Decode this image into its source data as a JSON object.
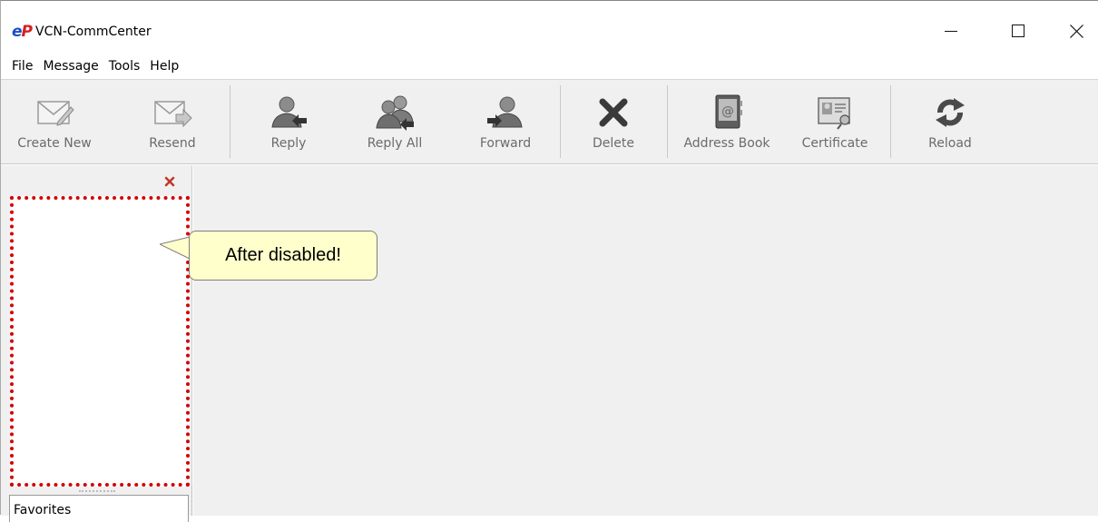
{
  "window": {
    "logo_e": "e",
    "logo_p": "P",
    "title": "VCN-CommCenter"
  },
  "menu": {
    "items": [
      "File",
      "Message",
      "Tools",
      "Help"
    ]
  },
  "toolbar": {
    "buttons": [
      {
        "label": "Create New",
        "icon": "envelope-pencil-icon",
        "enabled": false
      },
      {
        "label": "Resend",
        "icon": "envelope-arrow-icon",
        "enabled": false
      },
      {
        "label": "Reply",
        "icon": "person-reply-icon",
        "enabled": true
      },
      {
        "label": "Reply All",
        "icon": "people-reply-icon",
        "enabled": true
      },
      {
        "label": "Forward",
        "icon": "person-forward-icon",
        "enabled": true
      },
      {
        "label": "Delete",
        "icon": "x-delete-icon",
        "enabled": true
      },
      {
        "label": "Address Book",
        "icon": "address-book-icon",
        "enabled": true
      },
      {
        "label": "Certificate",
        "icon": "certificate-icon",
        "enabled": true
      },
      {
        "label": "Reload",
        "icon": "reload-icon",
        "enabled": true
      }
    ]
  },
  "left_panel": {
    "favorites_label": "Favorites"
  },
  "callout": {
    "text": "After disabled!"
  },
  "colors": {
    "highlight_border": "#d40000",
    "callout_bg": "#ffffcc",
    "logo_blue": "#1a4fbf",
    "logo_red": "#d81e1e"
  }
}
